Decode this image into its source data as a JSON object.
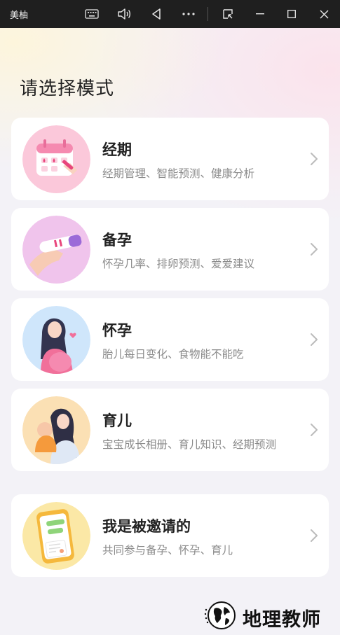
{
  "window": {
    "title": "美柚",
    "buttons": [
      "keyboard-icon",
      "volume-icon",
      "back-triangle-icon",
      "more-icon",
      "pip-icon",
      "minimize-icon",
      "maximize-icon",
      "close-icon"
    ]
  },
  "page": {
    "title": "请选择模式"
  },
  "modes": [
    {
      "title": "经期",
      "subtitle": "经期管理、智能预测、健康分析"
    },
    {
      "title": "备孕",
      "subtitle": "怀孕几率、排卵预测、爱爱建议"
    },
    {
      "title": "怀孕",
      "subtitle": "胎儿每日变化、食物能不能吃"
    },
    {
      "title": "育儿",
      "subtitle": "宝宝成长相册、育儿知识、经期预测"
    },
    {
      "title": "我是被邀请的",
      "subtitle": "共同参与备孕、怀孕、育儿"
    }
  ],
  "watermark": {
    "text": "地理教师"
  },
  "colors": {
    "titlebar": "#1f1f1f",
    "card": "#ffffff",
    "title_text": "#222222",
    "subtitle_text": "#8a8a8a"
  }
}
